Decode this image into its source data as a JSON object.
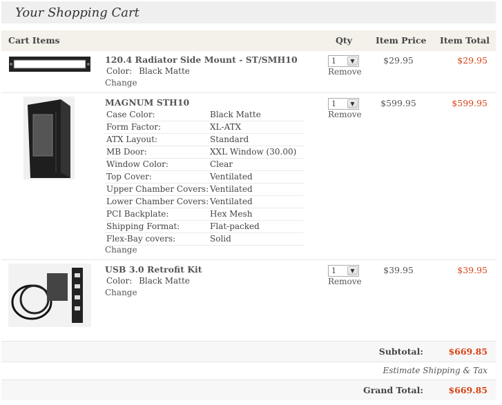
{
  "page": {
    "title": "Your Shopping Cart"
  },
  "table_header": {
    "items": "Cart Items",
    "qty": "Qty",
    "price": "Item Price",
    "total": "Item Total"
  },
  "items": [
    {
      "name": "120.4 Radiator Side Mount - ST/SMH10",
      "color_label": "Color:",
      "color_value": "Black Matte",
      "change": "Change",
      "qty": "1",
      "remove": "Remove",
      "price": "$29.95",
      "total": "$29.95"
    },
    {
      "name": "MAGNUM STH10",
      "options": [
        {
          "k": "Case Color:",
          "v": "Black Matte"
        },
        {
          "k": "Form Factor:",
          "v": "XL-ATX"
        },
        {
          "k": "ATX Layout:",
          "v": "Standard"
        },
        {
          "k": "MB Door:",
          "v": "XXL Window (30.00)"
        },
        {
          "k": "Window Color:",
          "v": "Clear"
        },
        {
          "k": "Top Cover:",
          "v": "Ventilated"
        },
        {
          "k": "Upper Chamber Covers:",
          "v": "Ventilated"
        },
        {
          "k": "Lower Chamber Covers:",
          "v": "Ventilated"
        },
        {
          "k": "PCI Backplate:",
          "v": "Hex Mesh"
        },
        {
          "k": "Shipping Format:",
          "v": "Flat-packed"
        },
        {
          "k": "Flex-Bay covers:",
          "v": "Solid"
        }
      ],
      "change": "Change",
      "qty": "1",
      "remove": "Remove",
      "price": "$599.95",
      "total": "$599.95"
    },
    {
      "name": "USB 3.0 Retrofit Kit",
      "color_label": "Color:",
      "color_value": "Black Matte",
      "change": "Change",
      "qty": "1",
      "remove": "Remove",
      "price": "$39.95",
      "total": "$39.95"
    }
  ],
  "summary": {
    "subtotal_label": "Subtotal:",
    "subtotal": "$669.85",
    "estimate": "Estimate Shipping & Tax",
    "grand_label": "Grand Total:",
    "grand": "$669.85"
  },
  "colors": {
    "accent": "#d84315",
    "header_bg": "#f4f1ea"
  },
  "icons": {
    "qty_dropdown": "chevron-down-icon"
  }
}
